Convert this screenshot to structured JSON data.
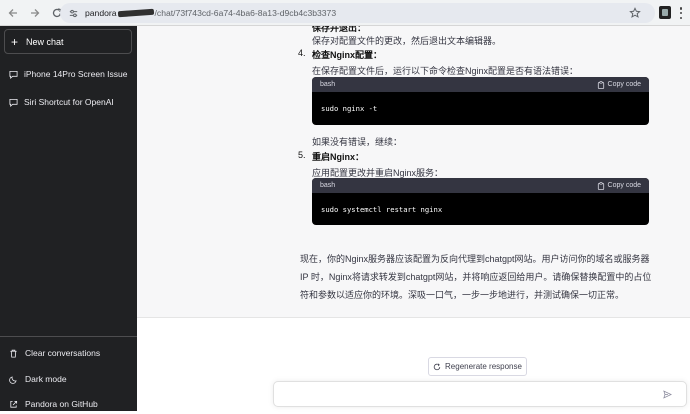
{
  "browser": {
    "url_host": "pandora",
    "url_path": "/chat/73f743cd-6a74-4ba6-8a13-d9cb4c3b3373"
  },
  "sidebar": {
    "new_chat": "New chat",
    "conversations": [
      {
        "label": "iPhone 14Pro Screen Issue"
      },
      {
        "label": "Siri Shortcut for OpenAI"
      }
    ],
    "bottom": [
      {
        "label": "Clear conversations",
        "icon": "trash-icon"
      },
      {
        "label": "Dark mode",
        "icon": "moon-icon"
      },
      {
        "label": "Pandora on GitHub",
        "icon": "github-icon"
      }
    ]
  },
  "message": {
    "partial_title": "保存并退出：",
    "partial_desc": "保存对配置文件的更改，然后退出文本编辑器。",
    "steps": [
      {
        "num": "4.",
        "title": "检查Nginx配置：",
        "desc": "在保存配置文件后，运行以下命令检查Nginx配置是否有语法错误：",
        "code_lang": "bash",
        "code": "sudo nginx -t",
        "after": "如果没有错误，继续："
      },
      {
        "num": "5.",
        "title": "重启Nginx：",
        "desc": "应用配置更改并重启Nginx服务：",
        "code_lang": "bash",
        "code": "sudo systemctl restart nginx"
      }
    ],
    "copy_label": "Copy code",
    "summary": "现在，你的Nginx服务器应该配置为反向代理到chatgpt网站。用户访问你的域名或服务器 IP 时，Nginx将请求转发到chatgpt网站，并将响应返回给用户。请确保替换配置中的占位符和参数以适应你的环境。深吸一口气，一步一步地进行，并测试确保一切正常。"
  },
  "composer": {
    "regenerate_label": "Regenerate response",
    "input_value": ""
  },
  "colors": {
    "sidebar_bg": "#202123",
    "assistant_bg": "#f7f7f8",
    "code_bg": "#000000",
    "code_header_bg": "#343541"
  }
}
